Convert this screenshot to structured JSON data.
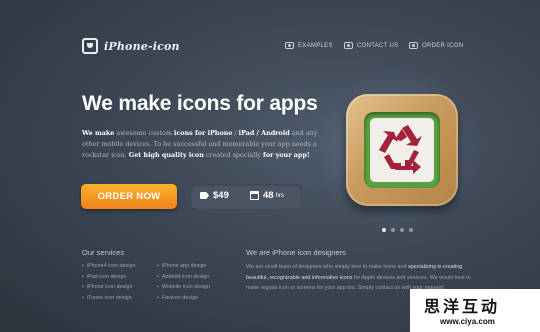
{
  "header": {
    "logo_text": "iPhone-icon",
    "nav": [
      {
        "label": "EXAMPLES"
      },
      {
        "label": "CONTACT US"
      },
      {
        "label": "ORDER ICON"
      }
    ]
  },
  "hero": {
    "headline": "We make icons for apps",
    "description": {
      "p1": "We make",
      "p2": " awesome custom ",
      "p3": "icons for iPhone",
      "p4": " / ",
      "p5": "iPad / Android",
      "p6": " and any other mobile devices. To be successful and memorable your app needs a rockstar icon. ",
      "p7": "Get high quality",
      "p8": " ",
      "p9": "icon",
      "p10": " created specially ",
      "p11": "for your app!"
    },
    "order_button": "ORDER NOW",
    "price": "$49",
    "turnaround": "48",
    "turnaround_unit": "hrs",
    "slider": {
      "count": 4,
      "active": 1
    }
  },
  "services": {
    "title": "Our services",
    "col1": [
      "iPhone4 icon design",
      "iPad icon design",
      "iPhone icon design",
      "iTunes icon design"
    ],
    "col2": [
      "iPhone app design",
      "Android icon design",
      "Website icon design",
      "Favicon design"
    ]
  },
  "about": {
    "title": "We are iPhone icon designers",
    "t1": "We are small team of designers who simply love to make icons and ",
    "t2": "specializing in creating beautiful, recognizable and informative icons",
    "t3": " for Apple devices and services. We would love to make regular icon or screens for your app too. Simply contact us with your request!"
  },
  "watermark": {
    "chinese": "思洋互动",
    "url": "www.ciya.com"
  },
  "colors": {
    "accent_orange": "#f59a22",
    "icon_green": "#5aa13f",
    "recycle_red": "#a3213a"
  }
}
